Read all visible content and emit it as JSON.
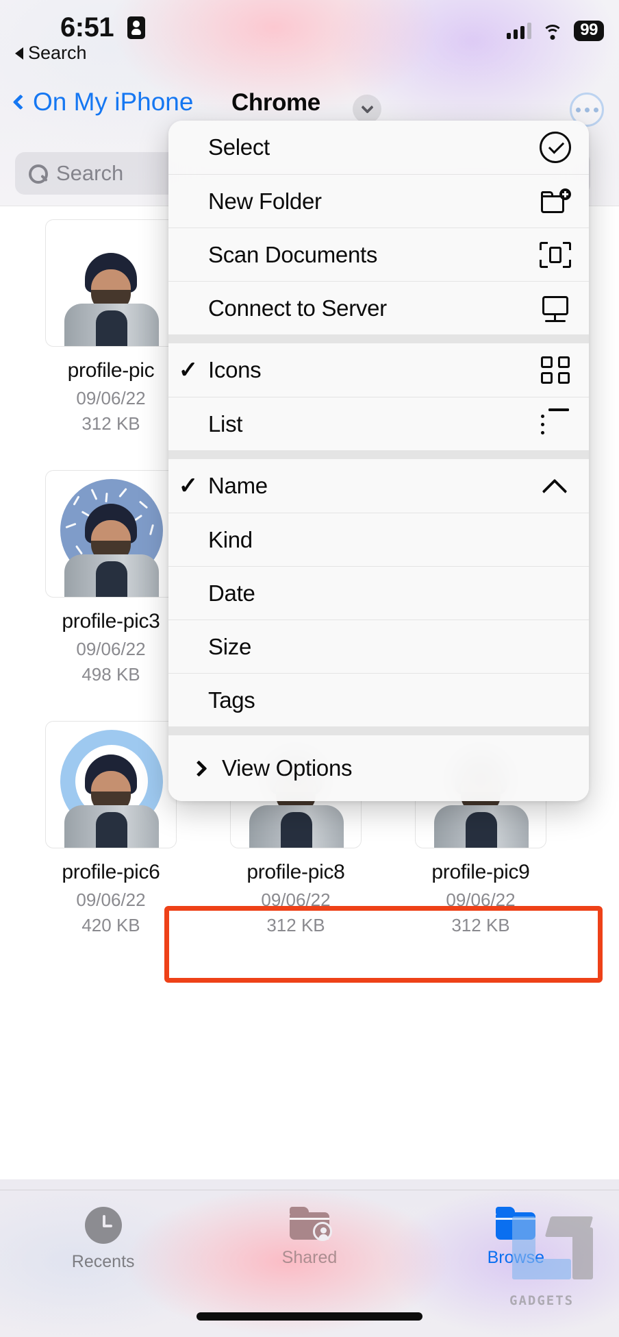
{
  "status_bar": {
    "time": "6:51",
    "recording_icon": "screen-record-icon",
    "back_label": "Search",
    "cellular_icon": "signal-bars-icon",
    "wifi_icon": "wifi-icon",
    "battery_level": "99"
  },
  "nav": {
    "back_label": "On My iPhone",
    "title": "Chrome",
    "caret_icon": "chevron-down-icon",
    "more_icon": "ellipsis-circle-icon"
  },
  "search": {
    "placeholder": "Search",
    "icon": "search-icon"
  },
  "files": [
    {
      "name": "profile-pic",
      "date": "09/06/22",
      "size": "312 KB",
      "style": "plain"
    },
    {
      "name": "profile-pic3",
      "date": "09/06/22",
      "size": "498 KB",
      "style": "speck"
    },
    {
      "name": "profile-pic6",
      "date": "09/06/22",
      "size": "420 KB",
      "style": "halo"
    },
    {
      "name": "profile-pic8",
      "date": "09/06/22",
      "size": "312 KB",
      "style": "plain"
    },
    {
      "name": "profile-pic9",
      "date": "09/06/22",
      "size": "312 KB",
      "style": "plain"
    }
  ],
  "context_menu": {
    "groups": [
      {
        "items": [
          {
            "label": "Select",
            "icon": "check-circle-icon",
            "checked": false
          },
          {
            "label": "New Folder",
            "icon": "new-folder-icon",
            "checked": false
          },
          {
            "label": "Scan Documents",
            "icon": "scan-documents-icon",
            "checked": false
          },
          {
            "label": "Connect to Server",
            "icon": "server-icon",
            "checked": false
          }
        ]
      },
      {
        "items": [
          {
            "label": "Icons",
            "icon": "grid-view-icon",
            "checked": true
          },
          {
            "label": "List",
            "icon": "list-view-icon",
            "checked": false
          }
        ]
      },
      {
        "items": [
          {
            "label": "Name",
            "icon": "chevron-up-icon",
            "checked": true
          },
          {
            "label": "Kind",
            "icon": "",
            "checked": false
          },
          {
            "label": "Date",
            "icon": "",
            "checked": false
          },
          {
            "label": "Size",
            "icon": "",
            "checked": false
          },
          {
            "label": "Tags",
            "icon": "",
            "checked": false
          }
        ]
      },
      {
        "items": [
          {
            "label": "View Options",
            "icon": "",
            "leading_icon": "chevron-right-icon",
            "checked": false,
            "highlighted": true
          }
        ]
      }
    ],
    "checkmark_glyph": "✓"
  },
  "highlight": {
    "color": "#EE4118",
    "target": "View Options"
  },
  "tab_bar": {
    "tabs": [
      {
        "label": "Recents",
        "icon": "clock-icon",
        "active": false
      },
      {
        "label": "Shared",
        "icon": "shared-folder-icon",
        "active": false
      },
      {
        "label": "Browse",
        "icon": "folder-icon",
        "active": true
      }
    ],
    "active_color": "#0a6ff0"
  },
  "watermark": {
    "text": "GADGETS",
    "logo_icon": "gt-logo-icon"
  }
}
